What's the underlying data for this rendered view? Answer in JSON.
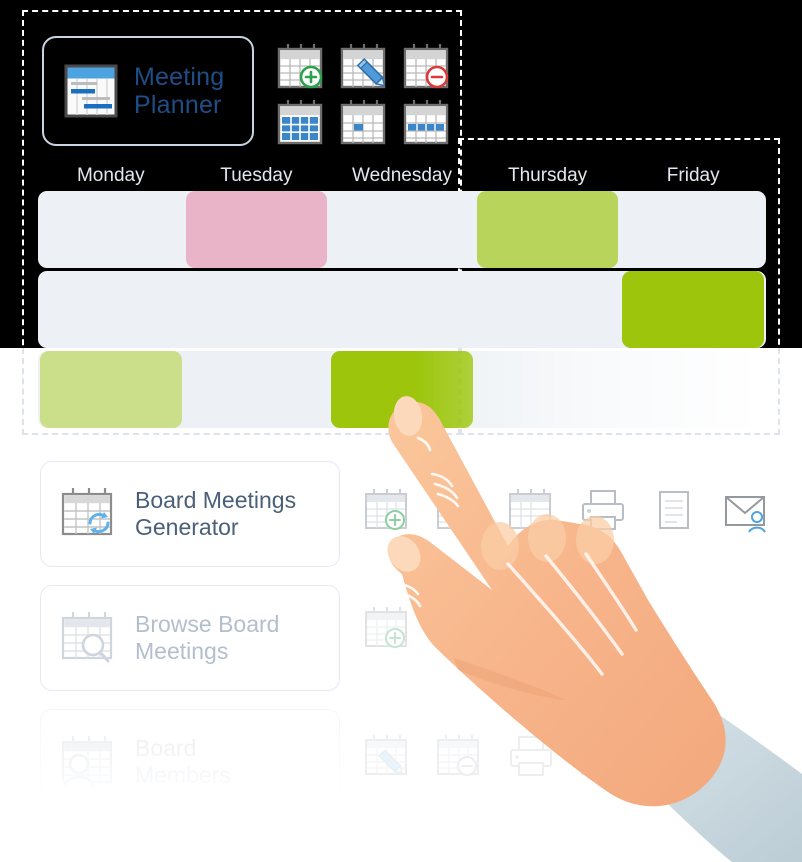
{
  "app": {
    "logo_title_line1": "Meeting",
    "logo_title_line2": "Planner",
    "logo_icon": "gantt-chart-icon",
    "accent_blue": "#1f4e87",
    "panel_background": "#000000",
    "selection_border_color": "#ffffff"
  },
  "toolbar": {
    "icons": [
      {
        "name": "calendar-add-icon",
        "badge": "plus",
        "badge_color": "#2aa14a"
      },
      {
        "name": "calendar-edit-icon",
        "badge": "pencil",
        "badge_color": "#3d8fd1"
      },
      {
        "name": "calendar-remove-icon",
        "badge": "minus",
        "badge_color": "#d93a3a"
      },
      {
        "name": "calendar-grid-full-icon",
        "badge": "none",
        "badge_color": "#2f7dc4"
      },
      {
        "name": "calendar-single-day-icon",
        "badge": "none",
        "badge_color": "#2f7dc4"
      },
      {
        "name": "calendar-week-row-icon",
        "badge": "none",
        "badge_color": "#2f7dc4"
      }
    ]
  },
  "schedule": {
    "weekdays": [
      "Monday",
      "Tuesday",
      "Wednesday",
      "Thursday",
      "Friday"
    ],
    "row_background": "#edf1f5",
    "colors": {
      "pink": "#e9b4c8",
      "green_light": "#b8d45a",
      "green_dark": "#9cc50c",
      "green_pale": "#cbdf8b"
    },
    "rows": [
      {
        "name": "schedule-row-1",
        "cells": [
          {
            "day": "Monday",
            "filled": false,
            "color": ""
          },
          {
            "day": "Tuesday",
            "filled": true,
            "color": "#e9b4c8"
          },
          {
            "day": "Wednesday",
            "filled": false,
            "color": ""
          },
          {
            "day": "Thursday",
            "filled": true,
            "color": "#b8d45a"
          },
          {
            "day": "Friday",
            "filled": false,
            "color": ""
          }
        ]
      },
      {
        "name": "schedule-row-2",
        "cells": [
          {
            "day": "Monday",
            "filled": false,
            "color": ""
          },
          {
            "day": "Tuesday",
            "filled": false,
            "color": ""
          },
          {
            "day": "Wednesday",
            "filled": false,
            "color": ""
          },
          {
            "day": "Thursday",
            "filled": false,
            "color": ""
          },
          {
            "day": "Friday",
            "filled": true,
            "color": "#9cc50c"
          }
        ]
      },
      {
        "name": "schedule-row-3",
        "cells": [
          {
            "day": "Monday",
            "filled": true,
            "color": "#cbdf8b"
          },
          {
            "day": "Tuesday",
            "filled": false,
            "color": ""
          },
          {
            "day": "Wednesday",
            "filled": true,
            "color": "#9cc50c"
          },
          {
            "day": "Thursday",
            "filled": false,
            "color": ""
          },
          {
            "day": "Friday",
            "filled": false,
            "color": ""
          }
        ]
      }
    ]
  },
  "menu": {
    "cards": [
      {
        "name": "board-meetings-generator",
        "label_line1": "Board Meetings",
        "label_line2": "Generator",
        "icon": "calendar-refresh-icon",
        "state": "active"
      },
      {
        "name": "browse-board-meetings",
        "label_line1": "Browse Board",
        "label_line2": "Meetings",
        "icon": "calendar-search-icon",
        "state": "dimmed"
      },
      {
        "name": "board-members",
        "label_line1": "Board",
        "label_line2": "Members",
        "icon": "calendar-person-icon",
        "state": "faded"
      }
    ]
  },
  "actions": {
    "row1": [
      {
        "name": "calendar-add-icon"
      },
      {
        "name": "calendar-plain-icon"
      },
      {
        "name": "calendar-check-icon"
      },
      {
        "name": "printer-icon"
      },
      {
        "name": "document-icon"
      },
      {
        "name": "mail-contact-icon"
      }
    ],
    "row2": [
      {
        "name": "calendar-add-icon"
      },
      {
        "name": "calendar-edit-icon"
      }
    ],
    "row3": [
      {
        "name": "calendar-edit-icon"
      },
      {
        "name": "calendar-remove-icon"
      },
      {
        "name": "printer-icon"
      },
      {
        "name": "calendar-add-icon"
      }
    ]
  },
  "cursor": {
    "name": "pointing-hand-illustration",
    "skin_color": "#f6b183",
    "cuff_color": "#ccd9e0",
    "target_day": "Wednesday",
    "target_row": 3
  }
}
